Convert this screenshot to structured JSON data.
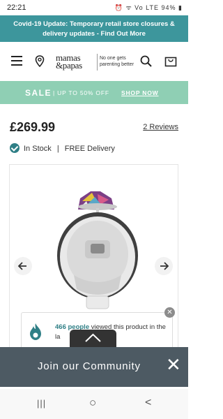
{
  "status_bar": {
    "time": "22:21",
    "icons": "⏰ ᯤ Vo LTE 94% ▮"
  },
  "banner": {
    "line1": "Covid-19 Update: Temporary retail store closures &",
    "line2": "delivery updates - Find Out More"
  },
  "header": {
    "logo_line1": "mamas",
    "logo_line2": "&papas",
    "tagline_line1": "No one gets",
    "tagline_line2": "parenting better"
  },
  "sale": {
    "label": "SALE",
    "sub": "UP TO 50% OFF",
    "cta": "SHOP NOW"
  },
  "product": {
    "price": "£269.99",
    "reviews": "2 Reviews",
    "stock": "In Stock",
    "separator": "|",
    "delivery": "FREE Delivery"
  },
  "viewers": {
    "count": "466 people",
    "text": "viewed this product in the la"
  },
  "community": {
    "title": "Join our Community"
  },
  "nav": {
    "recent": "|||",
    "home": "○",
    "back": "<"
  },
  "colors": {
    "teal": "#3d969c",
    "mint": "#8fcfb4",
    "slate": "#4d5a63"
  }
}
